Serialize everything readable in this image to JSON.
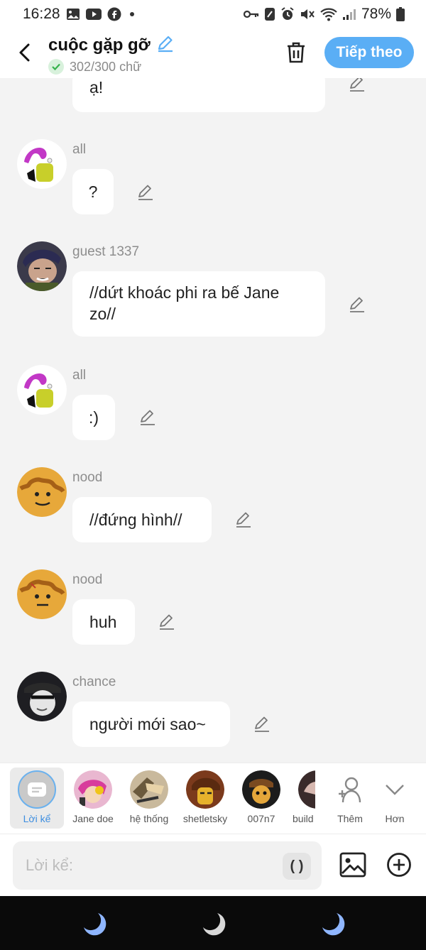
{
  "status": {
    "time": "16:28",
    "battery": "78%",
    "left_icons": [
      "gallery-icon",
      "youtube-icon",
      "facebook-icon"
    ],
    "right_icons": [
      "key-icon",
      "nfc-icon",
      "alarm-icon",
      "mute-icon",
      "wifi-icon",
      "signal-icon",
      "battery-icon"
    ]
  },
  "header": {
    "title": "cuộc gặp gỡ",
    "count": "302/300 chữ",
    "next_label": "Tiếp theo"
  },
  "messages": [
    {
      "name": "",
      "text": "ạ!",
      "avatar": "none"
    },
    {
      "name": "all",
      "text": "?",
      "avatar": "all"
    },
    {
      "name": "guest 1337",
      "text": "//dứt khoác phi ra bế Jane zo//",
      "avatar": "guest"
    },
    {
      "name": "all",
      "text": ":)",
      "avatar": "all"
    },
    {
      "name": "nood",
      "text": "//đứng hình//",
      "avatar": "nood"
    },
    {
      "name": "nood",
      "text": "huh",
      "avatar": "nood"
    },
    {
      "name": "chance",
      "text": "người mới sao~",
      "avatar": "chance"
    }
  ],
  "characters": [
    {
      "label": "Lời kể"
    },
    {
      "label": "Jane doe"
    },
    {
      "label": "hệ thống"
    },
    {
      "label": "shetletsky"
    },
    {
      "label": "007n7"
    },
    {
      "label": "build"
    },
    {
      "label": "Thêm"
    },
    {
      "label": "Hơn"
    }
  ],
  "input": {
    "placeholder": "Lời kể:",
    "paren_label": "( )"
  },
  "colors": {
    "accent": "#5aaef5",
    "background": "#f3f3f3",
    "bubble": "#ffffff",
    "nav": "#0a0a0a"
  }
}
